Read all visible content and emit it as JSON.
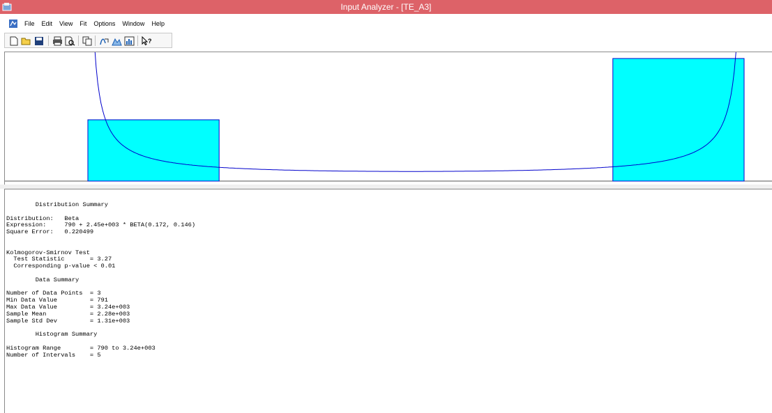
{
  "window": {
    "title": "Input Analyzer - [TE_A3]"
  },
  "menu": {
    "items": [
      "File",
      "Edit",
      "View",
      "Fit",
      "Options",
      "Window",
      "Help"
    ]
  },
  "toolbar": {
    "buttons": [
      "new-icon",
      "open-icon",
      "save-icon",
      "print-icon",
      "print-preview-icon",
      "copy-icon",
      "fit-all-icon",
      "histogram-icon",
      "fit-summary-icon",
      "help-pointer-icon"
    ]
  },
  "colors": {
    "titlebar": "#dd6268",
    "bar_fill": "#00ffff",
    "bar_stroke": "#0000cc",
    "curve": "#0000cc"
  },
  "chart_data": {
    "type": "bar",
    "description_visible": "histogram with fitted beta density curve",
    "bins": [
      {
        "from": 790,
        "to": 1280,
        "count": 1
      },
      {
        "from": 1280,
        "to": 1770,
        "count": 0
      },
      {
        "from": 1770,
        "to": 2260,
        "count": 0
      },
      {
        "from": 2260,
        "to": 2750,
        "count": 0
      },
      {
        "from": 2750,
        "to": 3240,
        "count": 2
      }
    ],
    "xlim": [
      790,
      3240
    ],
    "fit": {
      "distribution": "Beta",
      "offset": 790,
      "scale": 2450,
      "alpha": 0.172,
      "beta": 0.146
    }
  },
  "report": {
    "lines": [
      "        Distribution Summary",
      "",
      "Distribution:   Beta",
      "Expression:     790 + 2.45e+003 * BETA(0.172, 0.146)",
      "Square Error:   0.220499",
      "",
      "",
      "Kolmogorov-Smirnov Test",
      "  Test Statistic       = 3.27",
      "  Corresponding p-value < 0.01",
      "",
      "        Data Summary",
      "",
      "Number of Data Points  = 3",
      "Min Data Value         = 791",
      "Max Data Value         = 3.24e+003",
      "Sample Mean            = 2.28e+003",
      "Sample Std Dev         = 1.31e+003",
      "",
      "        Histogram Summary",
      "",
      "Histogram Range        = 790 to 3.24e+003",
      "Number of Intervals    = 5"
    ]
  }
}
